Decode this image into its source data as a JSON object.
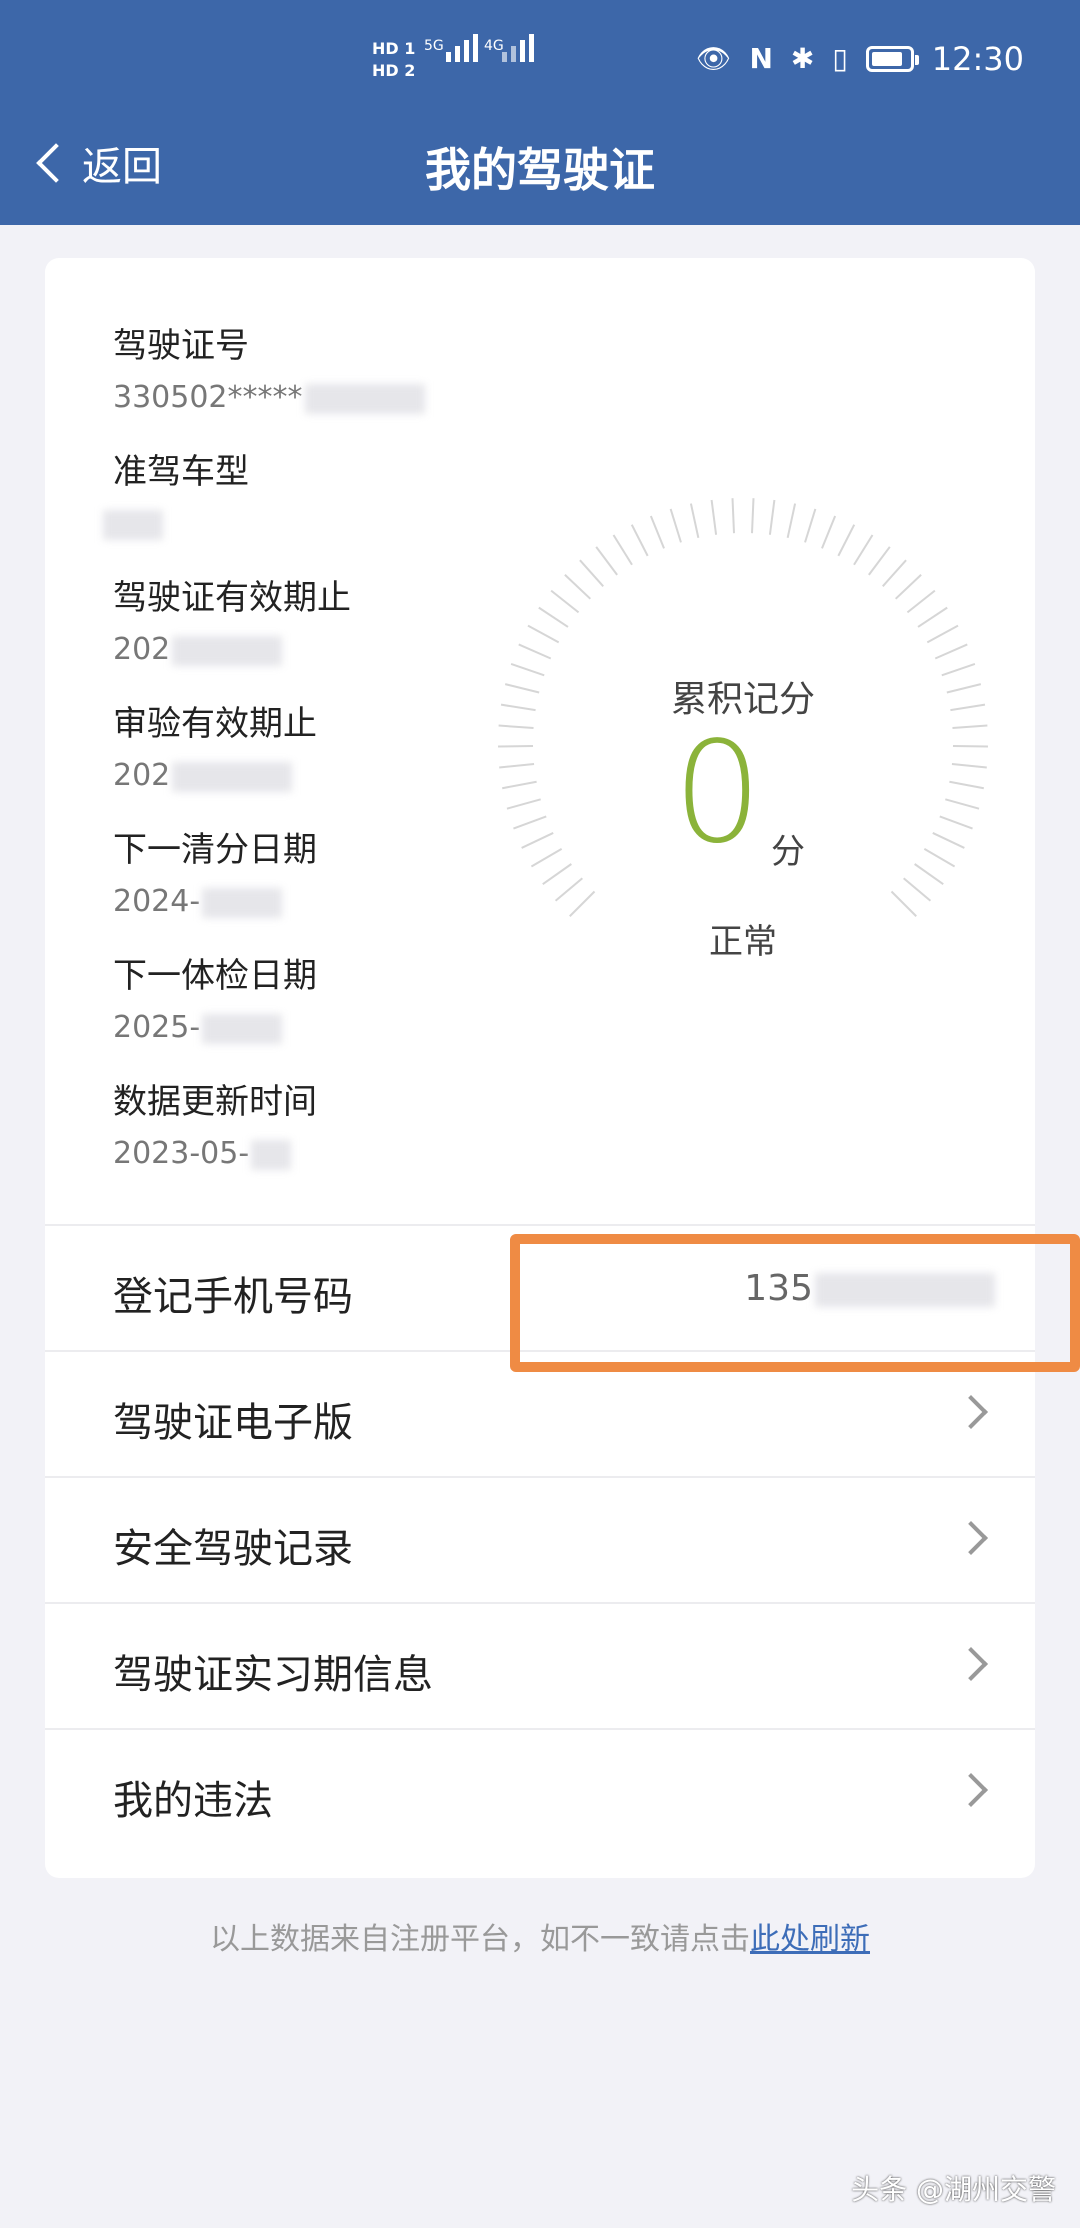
{
  "status_bar": {
    "sim1": "HD 1",
    "sim2": "HD 2",
    "net1": "5G",
    "net2": "4G",
    "time": "12:30",
    "battery_level": 0.85
  },
  "nav": {
    "back_label": "返回",
    "title": "我的驾驶证"
  },
  "license": {
    "fields": [
      {
        "label": "驾驶证号",
        "value": "330502*****"
      },
      {
        "label": "准驾车型",
        "value": ""
      },
      {
        "label": "驾驶证有效期止",
        "value": "202"
      },
      {
        "label": "审验有效期止",
        "value": "202"
      },
      {
        "label": "下一清分日期",
        "value": "2024-"
      },
      {
        "label": "下一体检日期",
        "value": "2025-"
      },
      {
        "label": "数据更新时间",
        "value": "2023-05-"
      }
    ]
  },
  "score": {
    "label": "累积记分",
    "value": "0",
    "unit": "分",
    "status": "正常"
  },
  "phone_row": {
    "label": "登记手机号码",
    "value": "135"
  },
  "menu": [
    {
      "label": "驾驶证电子版"
    },
    {
      "label": "安全驾驶记录"
    },
    {
      "label": "驾驶证实习期信息"
    },
    {
      "label": "我的违法"
    }
  ],
  "footer": {
    "text": "以上数据来自注册平台，如不一致请点击",
    "link": "此处刷新"
  },
  "watermark": "头条 @湖州交警",
  "colors": {
    "header": "#3d67a9",
    "score": "#8bb33a",
    "highlight": "#ef8b44",
    "link": "#3d6db8"
  }
}
